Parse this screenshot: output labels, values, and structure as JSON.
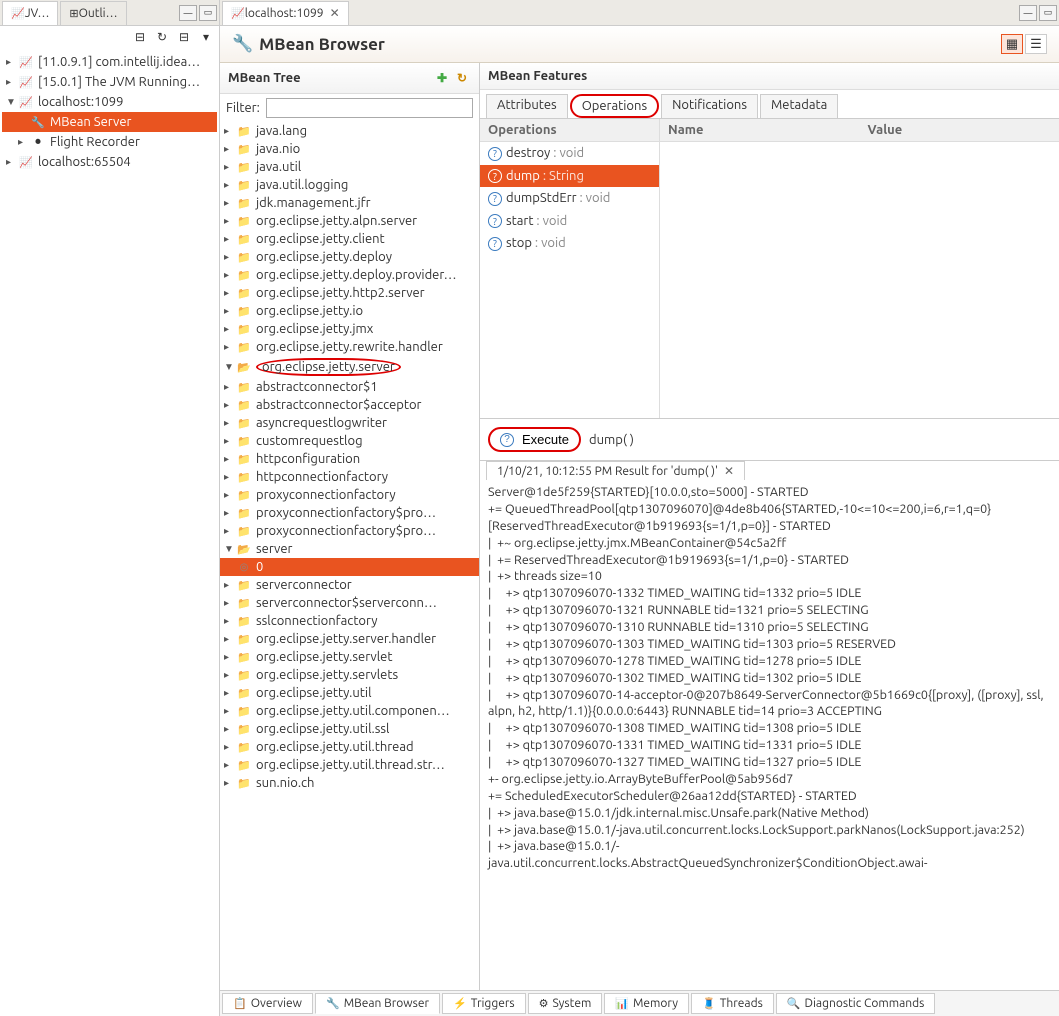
{
  "left_tabs": {
    "jv": "JV…",
    "outline": "Outli…"
  },
  "main_tab": {
    "label": "localhost:1099"
  },
  "jvms": [
    {
      "label": "[11.0.9.1] com.intellij.idea…"
    },
    {
      "label": "[15.0.1] The JVM Running…"
    },
    {
      "label": "localhost:1099",
      "expanded": true,
      "children": [
        {
          "label": "MBean Server",
          "selected": true
        },
        {
          "label": "Flight Recorder"
        }
      ]
    },
    {
      "label": "localhost:65504"
    }
  ],
  "header_title": "MBean Browser",
  "mbean_tree_title": "MBean Tree",
  "filter_label": "Filter:",
  "filter_value": "",
  "mbean_tree": [
    {
      "l": "java.lang",
      "d": 1
    },
    {
      "l": "java.nio",
      "d": 1
    },
    {
      "l": "java.util",
      "d": 1
    },
    {
      "l": "java.util.logging",
      "d": 1
    },
    {
      "l": "jdk.management.jfr",
      "d": 1
    },
    {
      "l": "org.eclipse.jetty.alpn.server",
      "d": 1
    },
    {
      "l": "org.eclipse.jetty.client",
      "d": 1
    },
    {
      "l": "org.eclipse.jetty.deploy",
      "d": 1
    },
    {
      "l": "org.eclipse.jetty.deploy.provider…",
      "d": 1
    },
    {
      "l": "org.eclipse.jetty.http2.server",
      "d": 1
    },
    {
      "l": "org.eclipse.jetty.io",
      "d": 1
    },
    {
      "l": "org.eclipse.jetty.jmx",
      "d": 1
    },
    {
      "l": "org.eclipse.jetty.rewrite.handler",
      "d": 1
    },
    {
      "l": "org.eclipse.jetty.server",
      "d": 1,
      "open": true,
      "circled": true,
      "children": [
        {
          "l": "abstractconnector$1",
          "d": 2
        },
        {
          "l": "abstractconnector$acceptor",
          "d": 2
        },
        {
          "l": "asyncrequestlogwriter",
          "d": 2
        },
        {
          "l": "customrequestlog",
          "d": 2
        },
        {
          "l": "httpconfiguration",
          "d": 2
        },
        {
          "l": "httpconnectionfactory",
          "d": 2
        },
        {
          "l": "proxyconnectionfactory",
          "d": 2
        },
        {
          "l": "proxyconnectionfactory$pro…",
          "d": 2
        },
        {
          "l": "proxyconnectionfactory$pro…",
          "d": 2
        },
        {
          "l": "server",
          "d": 2,
          "open": true,
          "children": [
            {
              "l": "0",
              "d": 3,
              "selected": true,
              "bean": true
            }
          ]
        },
        {
          "l": "serverconnector",
          "d": 2
        },
        {
          "l": "serverconnector$serverconn…",
          "d": 2
        },
        {
          "l": "sslconnectionfactory",
          "d": 2
        }
      ]
    },
    {
      "l": "org.eclipse.jetty.server.handler",
      "d": 1
    },
    {
      "l": "org.eclipse.jetty.servlet",
      "d": 1
    },
    {
      "l": "org.eclipse.jetty.servlets",
      "d": 1
    },
    {
      "l": "org.eclipse.jetty.util",
      "d": 1
    },
    {
      "l": "org.eclipse.jetty.util.componen…",
      "d": 1
    },
    {
      "l": "org.eclipse.jetty.util.ssl",
      "d": 1
    },
    {
      "l": "org.eclipse.jetty.util.thread",
      "d": 1
    },
    {
      "l": "org.eclipse.jetty.util.thread.str…",
      "d": 1
    },
    {
      "l": "sun.nio.ch",
      "d": 1
    }
  ],
  "features_title": "MBean Features",
  "feature_tabs": [
    "Attributes",
    "Operations",
    "Notifications",
    "Metadata"
  ],
  "feature_active": 1,
  "ops_header": "Operations",
  "params_headers": [
    "Name",
    "Value"
  ],
  "operations": [
    {
      "name": "destroy",
      "rtype": "void"
    },
    {
      "name": "dump",
      "rtype": "String",
      "selected": true
    },
    {
      "name": "dumpStdErr",
      "rtype": "void"
    },
    {
      "name": "start",
      "rtype": "void"
    },
    {
      "name": "stop",
      "rtype": "void"
    }
  ],
  "execute_label": "Execute",
  "invocation_sig": "dump( )",
  "result_tab_label": "1/10/21, 10:12:55 PM Result for 'dump( )'",
  "result_text": "Server@1de5f259{STARTED}[10.0.0,sto=5000] - STARTED\n+= QueuedThreadPool[qtp1307096070]@4de8b406{STARTED,-10<=10<=200,i=6,r=1,q=0}[ReservedThreadExecutor@1b919693{s=1/1,p=0}] - STARTED\n|  +~ org.eclipse.jetty.jmx.MBeanContainer@54c5a2ff\n|  += ReservedThreadExecutor@1b919693{s=1/1,p=0} - STARTED\n|  +> threads size=10\n|     +> qtp1307096070-1332 TIMED_WAITING tid=1332 prio=5 IDLE\n|     +> qtp1307096070-1321 RUNNABLE tid=1321 prio=5 SELECTING\n|     +> qtp1307096070-1310 RUNNABLE tid=1310 prio=5 SELECTING\n|     +> qtp1307096070-1303 TIMED_WAITING tid=1303 prio=5 RESERVED\n|     +> qtp1307096070-1278 TIMED_WAITING tid=1278 prio=5 IDLE\n|     +> qtp1307096070-1302 TIMED_WAITING tid=1302 prio=5 IDLE\n|     +> qtp1307096070-14-acceptor-0@207b8649-ServerConnector@5b1669c0{[proxy], ([proxy], ssl, alpn, h2, http/1.1)}{0.0.0.0:6443} RUNNABLE tid=14 prio=3 ACCEPTING\n|     +> qtp1307096070-1308 TIMED_WAITING tid=1308 prio=5 IDLE\n|     +> qtp1307096070-1331 TIMED_WAITING tid=1331 prio=5 IDLE\n|     +> qtp1307096070-1327 TIMED_WAITING tid=1327 prio=5 IDLE\n+- org.eclipse.jetty.io.ArrayByteBufferPool@5ab956d7\n+= ScheduledExecutorScheduler@26aa12dd{STARTED} - STARTED\n|  +> java.base@15.0.1/jdk.internal.misc.Unsafe.park(Native Method)\n|  +> java.base@15.0.1/-java.util.concurrent.locks.LockSupport.parkNanos(LockSupport.java:252)\n|  +> java.base@15.0.1/-java.util.concurrent.locks.AbstractQueuedSynchronizer$ConditionObject.awai-",
  "bottom_tabs": [
    {
      "icon": "📋",
      "label": "Overview"
    },
    {
      "icon": "🔧",
      "label": "MBean Browser",
      "active": true
    },
    {
      "icon": "⚡",
      "label": "Triggers"
    },
    {
      "icon": "⚙",
      "label": "System"
    },
    {
      "icon": "📊",
      "label": "Memory"
    },
    {
      "icon": "🧵",
      "label": "Threads"
    },
    {
      "icon": "🔍",
      "label": "Diagnostic Commands"
    }
  ]
}
